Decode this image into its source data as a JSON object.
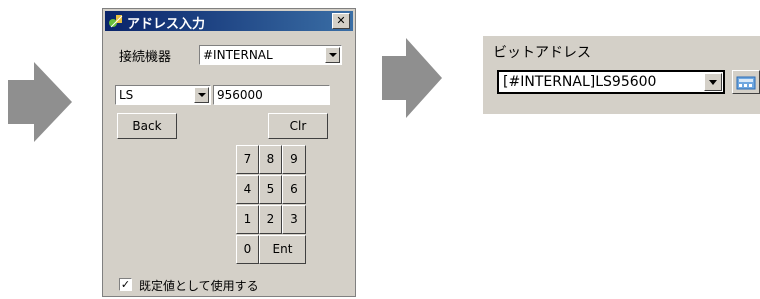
{
  "dialog": {
    "title": "アドレス入力",
    "close_label": "✕",
    "device_label": "接続機器",
    "device_value": "#INTERNAL",
    "type_value": "LS",
    "address_value": "956000",
    "back_label": "Back",
    "clr_label": "Clr",
    "keys": [
      "7",
      "8",
      "9",
      "4",
      "5",
      "6",
      "1",
      "2",
      "3",
      "0"
    ],
    "ent_label": "Ent",
    "checkbox_mark": "✓",
    "checkbox_label": "既定値として使用する"
  },
  "panel": {
    "label": "ビットアドレス",
    "address_value": "[#INTERNAL]LS95600"
  },
  "colors": {
    "arrow": "#8f8f8f",
    "dialog_bg": "#d4d0c8",
    "titlebar_start": "#0a246a",
    "titlebar_end": "#3a6ea5"
  },
  "icons": [
    "arrow-right-icon",
    "dialog-app-icon",
    "close-icon",
    "dropdown-arrow-icon",
    "keypad-icon"
  ]
}
